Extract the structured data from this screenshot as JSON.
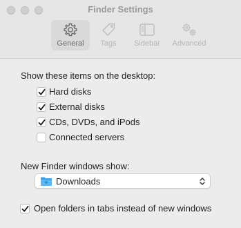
{
  "window": {
    "title": "Finder Settings"
  },
  "tabs": [
    {
      "label": "General",
      "icon": "gear-icon",
      "selected": true
    },
    {
      "label": "Tags",
      "icon": "tag-icon",
      "selected": false
    },
    {
      "label": "Sidebar",
      "icon": "sidebar-icon",
      "selected": false
    },
    {
      "label": "Advanced",
      "icon": "advanced-gears-icon",
      "selected": false
    }
  ],
  "desktop_section": {
    "heading": "Show these items on the desktop:",
    "items": [
      {
        "label": "Hard disks",
        "checked": true
      },
      {
        "label": "External disks",
        "checked": true
      },
      {
        "label": "CDs, DVDs, and iPods",
        "checked": true
      },
      {
        "label": "Connected servers",
        "checked": false
      }
    ]
  },
  "new_window": {
    "heading": "New Finder windows show:",
    "selected": "Downloads",
    "icon": "folder-icon"
  },
  "tabs_option": {
    "label": "Open folders in tabs instead of new windows",
    "checked": true
  },
  "colors": {
    "background": "#ececec",
    "folder_blue": "#3aa2e8",
    "text": "#1f1f1f"
  }
}
